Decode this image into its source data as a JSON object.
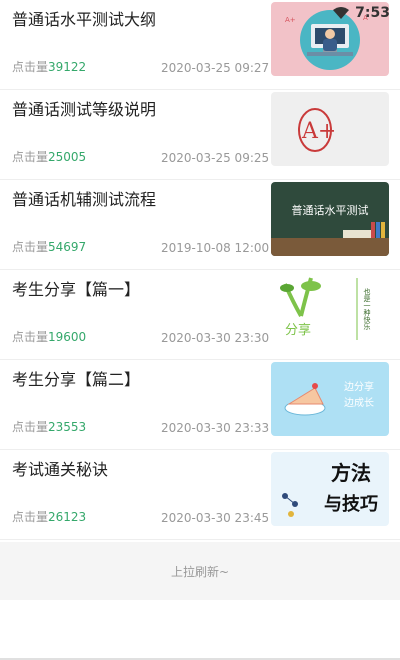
{
  "status_bar": {
    "time": "7:53"
  },
  "articles": [
    {
      "title": "普通话水平测试大纲",
      "clicks_label": "点击量",
      "clicks": "39122",
      "date": "2020-03-25 09:27",
      "thumb": {
        "caption": ""
      }
    },
    {
      "title": "普通话测试等级说明",
      "clicks_label": "点击量",
      "clicks": "25005",
      "date": "2020-03-25 09:25",
      "thumb": {
        "caption": "A+"
      }
    },
    {
      "title": "普通话机辅测试流程",
      "clicks_label": "点击量",
      "clicks": "54697",
      "date": "2019-10-08 12:00",
      "thumb": {
        "caption": "普通话水平测试"
      }
    },
    {
      "title": "考生分享【篇一】",
      "clicks_label": "点击量",
      "clicks": "19600",
      "date": "2020-03-30 23:30",
      "thumb": {
        "caption": "分享",
        "caption2": "也是一种快乐"
      }
    },
    {
      "title": "考生分享【篇二】",
      "clicks_label": "点击量",
      "clicks": "23553",
      "date": "2020-03-30 23:33",
      "thumb": {
        "caption": "边分享",
        "caption2": "边成长"
      }
    },
    {
      "title": "考试通关秘诀",
      "clicks_label": "点击量",
      "clicks": "26123",
      "date": "2020-03-30 23:45",
      "thumb": {
        "caption": "方法",
        "caption2": "与技巧"
      }
    }
  ],
  "pull_to_refresh": "上拉刷新~"
}
